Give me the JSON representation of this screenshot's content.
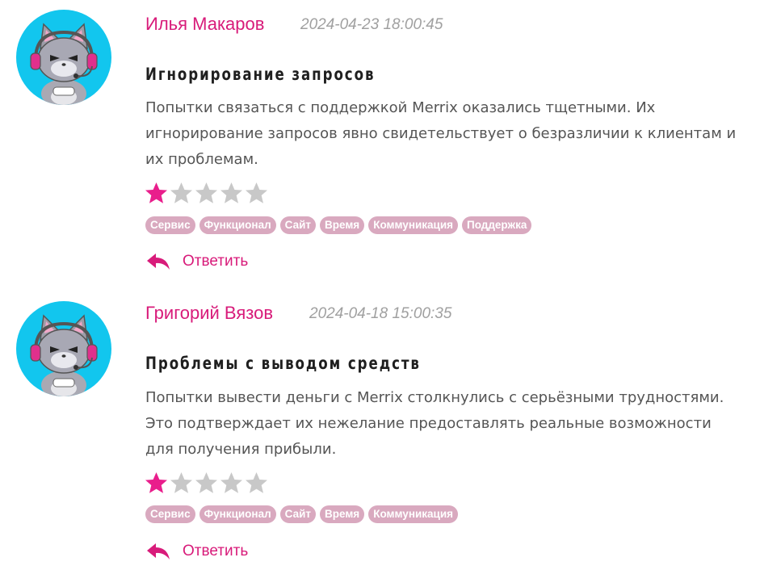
{
  "reviews": [
    {
      "author": "Илья Макаров",
      "date": "2024-04-23 18:00:45",
      "title": "Игнорирование запросов",
      "text": "Попытки связаться с поддержкой Merrix оказались тщетными. Их игнорирование запросов явно свидетельствует о безразличии к клиентам и их проблемам.",
      "rating": 1,
      "max_rating": 5,
      "tags": [
        "Сервис",
        "Функционал",
        "Сайт",
        "Время",
        "Коммуникация",
        "Поддержка"
      ],
      "reply_label": "Ответить"
    },
    {
      "author": "Григорий Вязов",
      "date": "2024-04-18 15:00:35",
      "title": "Проблемы с выводом средств",
      "text": "Попытки вывести деньги с Merrix столкнулись с серьёзными трудностями. Это подтверждает их нежелание предоставлять реальные возможности для получения прибыли.",
      "rating": 1,
      "max_rating": 5,
      "tags": [
        "Сервис",
        "Функционал",
        "Сайт",
        "Время",
        "Коммуникация"
      ],
      "reply_label": "Ответить"
    }
  ],
  "colors": {
    "accent": "#d81b7a",
    "star_filled": "#e91e8c",
    "star_empty": "#c8c8c8",
    "tag_bg": "#d9a9bf",
    "avatar_bg": "#12c6ee"
  },
  "icons": {
    "avatar": "gamer-cat-avatar-icon",
    "reply": "reply-arrow-icon",
    "star": "star-icon"
  }
}
